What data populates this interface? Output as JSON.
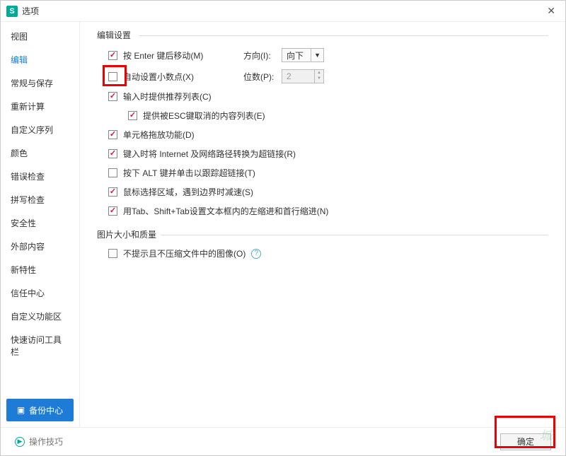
{
  "window": {
    "title": "选项",
    "close": "✕"
  },
  "sidebar": {
    "items": [
      {
        "label": "视图"
      },
      {
        "label": "编辑",
        "selected": true
      },
      {
        "label": "常规与保存"
      },
      {
        "label": "重新计算"
      },
      {
        "label": "自定义序列"
      },
      {
        "label": "颜色"
      },
      {
        "label": "错误检查"
      },
      {
        "label": "拼写检查"
      },
      {
        "label": "安全性"
      },
      {
        "label": "外部内容"
      },
      {
        "label": "新特性"
      },
      {
        "label": "信任中心"
      },
      {
        "label": "自定义功能区"
      },
      {
        "label": "快速访问工具栏"
      }
    ],
    "backup": "备份中心"
  },
  "group1": {
    "legend": "编辑设置",
    "enter_move": {
      "checked": true,
      "label": "按 Enter 键后移动(M)"
    },
    "direction": {
      "label": "方向(I):",
      "value": "向下"
    },
    "auto_decimal": {
      "checked": false,
      "label": "自动设置小数点(X)"
    },
    "digits": {
      "label": "位数(P):",
      "value": "2"
    },
    "suggest": {
      "checked": true,
      "label": "输入时提供推荐列表(C)"
    },
    "esc_list": {
      "checked": true,
      "label": "提供被ESC键取消的内容列表(E)"
    },
    "drag": {
      "checked": true,
      "label": "单元格拖放功能(D)"
    },
    "hyperlink": {
      "checked": true,
      "label": "键入时将 Internet 及网络路径转换为超链接(R)"
    },
    "alt_click": {
      "checked": false,
      "label": "按下 ALT 键并单击以跟踪超链接(T)"
    },
    "selection": {
      "checked": true,
      "label": "鼠标选择区域，遇到边界时减速(S)"
    },
    "tab_indent": {
      "checked": true,
      "label": "用Tab、Shift+Tab设置文本框内的左缩进和首行缩进(N)"
    }
  },
  "group2": {
    "legend": "图片大小和质量",
    "no_compress": {
      "checked": false,
      "label": "不提示且不压缩文件中的图像(O)"
    }
  },
  "footer": {
    "tips": "操作技巧",
    "ok": "确定"
  }
}
